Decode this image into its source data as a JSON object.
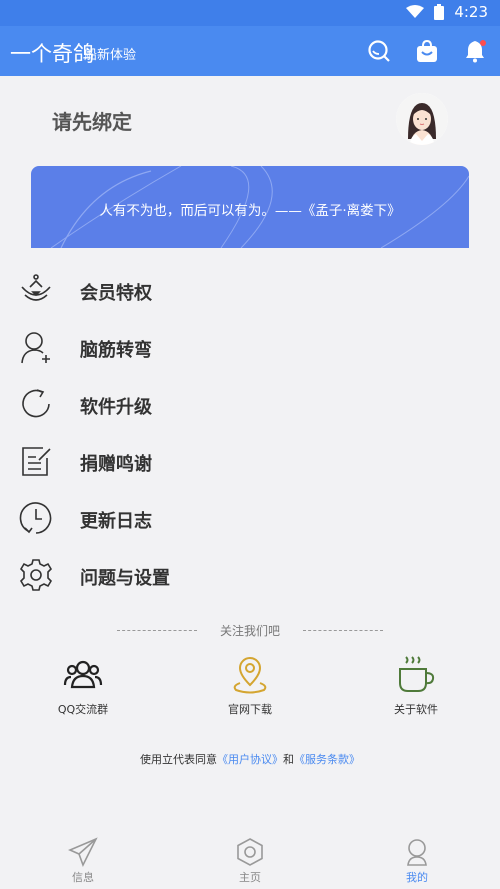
{
  "status_bar": {
    "time": "4:23"
  },
  "app_bar": {
    "title": "一个奇鸽",
    "subtitle": "船新体验",
    "actions": [
      "search-icon",
      "shopping-bag-icon",
      "bell-icon"
    ]
  },
  "profile": {
    "bind_text": "请先绑定"
  },
  "quote": {
    "text": "人有不为也，而后可以有为。——《孟子·离娄下》"
  },
  "menu": {
    "items": [
      {
        "label": "会员特权",
        "icon": "crown-icon"
      },
      {
        "label": "脑筋转弯",
        "icon": "add-user-icon"
      },
      {
        "label": "软件升级",
        "icon": "refresh-icon"
      },
      {
        "label": "捐赠鸣谢",
        "icon": "notes-icon"
      },
      {
        "label": "更新日志",
        "icon": "clock-icon"
      },
      {
        "label": "问题与设置",
        "icon": "gear-icon"
      }
    ]
  },
  "follow": {
    "title": "关注我们吧",
    "links": [
      {
        "label": "QQ交流群",
        "icon": "group-icon"
      },
      {
        "label": "官网下载",
        "icon": "location-pin-icon"
      },
      {
        "label": "关于软件",
        "icon": "coffee-icon"
      }
    ]
  },
  "agreement": {
    "prefix": "使用立代表同意",
    "user_agreement": "《用户协议》",
    "and": "和",
    "service_terms": "《服务条款》"
  },
  "tabs": [
    {
      "label": "信息",
      "icon": "send-icon"
    },
    {
      "label": "主页",
      "icon": "hexagon-icon"
    },
    {
      "label": "我的",
      "icon": "user-icon",
      "active": true
    }
  ],
  "colors": {
    "primary": "#4a8af0",
    "status_bar": "#3f7fea",
    "quote_bg": "#5b7fe8",
    "coin": "#d4a530",
    "coffee": "#4f7a3a"
  }
}
